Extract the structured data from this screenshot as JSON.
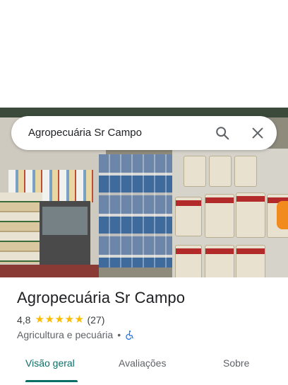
{
  "search": {
    "query": "Agropecuária Sr Campo"
  },
  "place": {
    "name": "Agropecuária Sr Campo",
    "rating": "4,8",
    "review_count": "(27)",
    "category": "Agricultura e pecuária",
    "separator": "•",
    "stars_filled": 5
  },
  "tabs": [
    {
      "label": "Visão geral",
      "active": true
    },
    {
      "label": "Avaliações",
      "active": false
    },
    {
      "label": "Sobre",
      "active": false
    }
  ],
  "icons": {
    "search": "search-icon",
    "close": "close-icon",
    "star": "star-icon",
    "accessibility": "wheelchair-accessible-icon"
  },
  "colors": {
    "accent": "#0b6e67",
    "star": "#fbbc04",
    "accessibility": "#1a73e8"
  }
}
